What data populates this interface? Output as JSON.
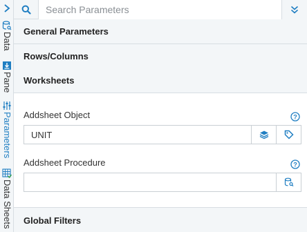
{
  "rail": {
    "tabs": [
      {
        "label": "Data",
        "icon": "database-search-icon"
      },
      {
        "label": "Pane",
        "icon": "pane-icon"
      },
      {
        "label": "Parameters",
        "icon": "sliders-icon"
      },
      {
        "label": "Data Sheets",
        "icon": "data-sheets-icon"
      }
    ]
  },
  "search": {
    "placeholder": "Search Parameters"
  },
  "sections": {
    "general": "General Parameters",
    "rows_columns": "Rows/Columns",
    "worksheets": "Worksheets",
    "global_filters": "Global Filters"
  },
  "worksheets": {
    "addsheet_object_label": "Addsheet Object",
    "addsheet_object_value": "UNIT",
    "addsheet_procedure_label": "Addsheet Procedure",
    "addsheet_procedure_value": ""
  },
  "colors": {
    "accent": "#1f7ec2",
    "panel_bg": "#f3f6f8",
    "border": "#d7dde2"
  }
}
